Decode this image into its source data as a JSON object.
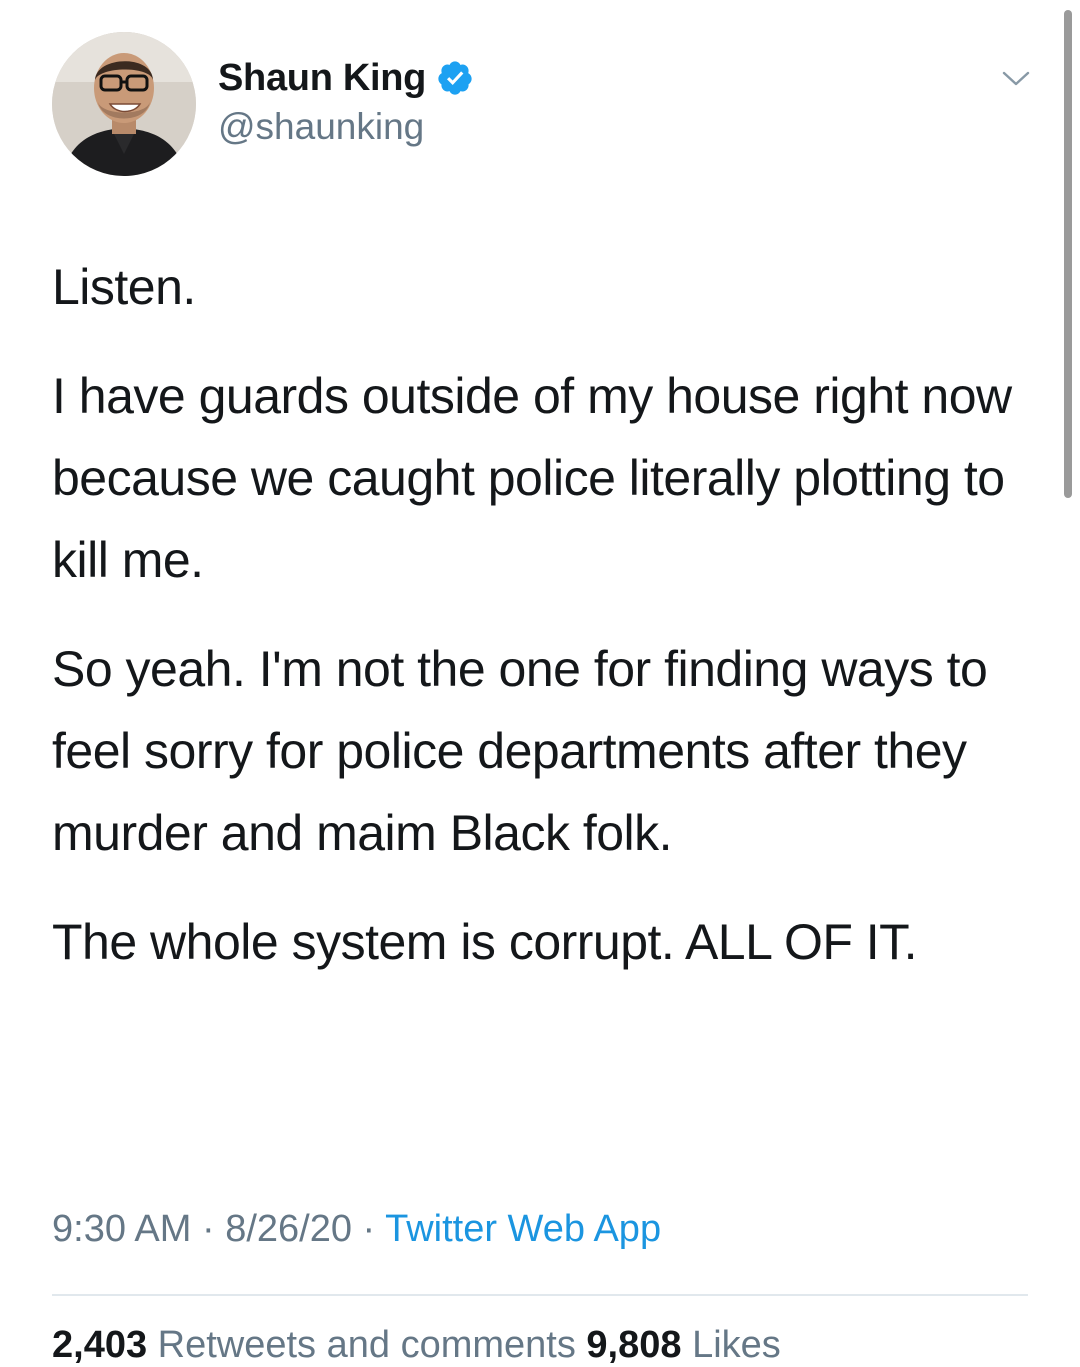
{
  "author": {
    "display_name": "Shaun King",
    "handle": "@shaunking",
    "verified": true,
    "avatar_icon": "profile-photo"
  },
  "tweet": {
    "paragraphs": [
      "Listen.",
      "I have guards outside of my house right now because we caught police literally plotting to kill me.",
      "So yeah. I'm not the one for finding ways to feel sorry for police departments after they murder and maim Black folk.",
      "The whole system is corrupt. ALL OF IT."
    ],
    "time": "9:30 AM",
    "separator": " · ",
    "date": "8/26/20",
    "source": "Twitter Web App"
  },
  "stats": {
    "retweets_count": "2,403",
    "retweets_label": "Retweets and comments",
    "likes_count": "9,808",
    "likes_label": "Likes"
  },
  "colors": {
    "text": "#14171a",
    "secondary": "#657786",
    "link": "#1b95e0",
    "verified": "#1da1f2"
  },
  "icons": {
    "verified": "verified-badge-icon",
    "menu": "chevron-down-icon"
  }
}
